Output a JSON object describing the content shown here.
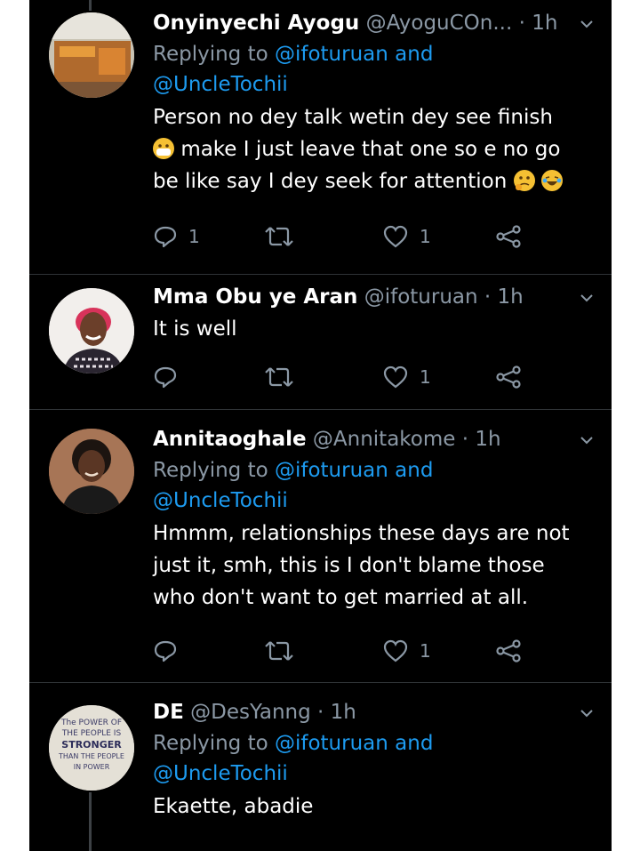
{
  "tweets": [
    {
      "name": "Onyinyechi Ayogu",
      "handle": "@AyoguCOn...",
      "time": "· 1h",
      "replying_prefix": "Replying to",
      "mention1": "@ifoturuan",
      "mention_join": "and",
      "mention2": "@UncleTochii",
      "text_line1": "Person no dey talk wetin dey see finish",
      "text_line2": "make I just leave that one so e no go",
      "text_line3": "be like say I dey seek for attention",
      "reply_count": "1",
      "retweet_count": "",
      "like_count": "1"
    },
    {
      "name": "Mma Obu ye Aran",
      "handle": "@ifoturuan",
      "time": "· 1h",
      "text": "It is well",
      "reply_count": "",
      "retweet_count": "",
      "like_count": "1"
    },
    {
      "name": "Annitaoghale",
      "handle": "@Annitakome",
      "time": "· 1h",
      "replying_prefix": "Replying to",
      "mention1": "@ifoturuan",
      "mention_join": "and",
      "mention2": "@UncleTochii",
      "text_line1": "Hmmm, relationships these days are not",
      "text_line2": "just it, smh, this is I don't blame those",
      "text_line3": "who don't want to get married at all.",
      "reply_count": "",
      "retweet_count": "",
      "like_count": "1"
    },
    {
      "name": "DE",
      "handle": "@DesYanng",
      "time": "· 1h",
      "replying_prefix": "Replying to",
      "mention1": "@ifoturuan",
      "mention_join": "and",
      "mention2": "@UncleTochii",
      "text": "Ekaette, abadie",
      "avatar_text": [
        "The POWER OF",
        "THE PEOPLE IS",
        "STRONGER",
        "THAN THE PEOPLE",
        "IN POWER"
      ]
    }
  ],
  "colors": {
    "background": "#000000",
    "name": "#ffffff",
    "secondary": "#8b98a5",
    "mention": "#1d9bf0",
    "divider": "#2f3336"
  },
  "icons": [
    "reply-icon",
    "retweet-icon",
    "like-icon",
    "share-icon",
    "chevron-down-icon"
  ]
}
